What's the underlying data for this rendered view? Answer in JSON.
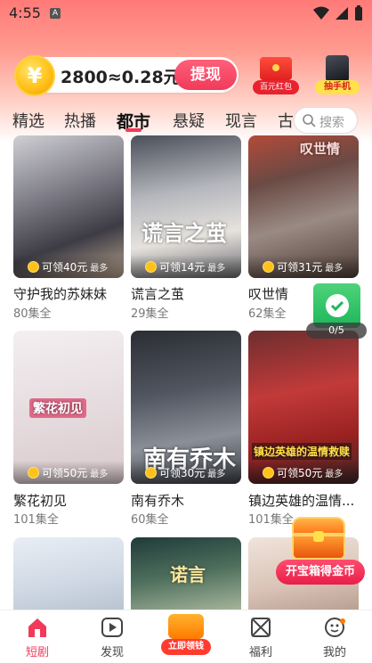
{
  "status_bar": {
    "time": "4:55",
    "notif_badge": "A"
  },
  "header": {
    "coin_text": "2800≈0.28元",
    "withdraw_label": "提现",
    "redpack_label": "百元红包",
    "phone_label": "抽手机",
    "coin_glyph": "¥"
  },
  "tabs": [
    "精选",
    "热播",
    "都市",
    "悬疑",
    "现言",
    "古言"
  ],
  "active_tab": "都市",
  "search": {
    "placeholder": "搜索"
  },
  "cards": [
    {
      "title": "守护我的苏妹妹",
      "episodes": "80集全",
      "reward": "可领40元",
      "more": "最多"
    },
    {
      "title": "谎言之茧",
      "episodes": "29集全",
      "reward": "可领14元",
      "more": "最多",
      "poster_text": "谎言之茧"
    },
    {
      "title": "叹世情",
      "episodes": "62集全",
      "reward": "可领31元",
      "more": "最多",
      "poster_text": "叹世情"
    },
    {
      "title": "繁花初见",
      "episodes": "101集全",
      "reward": "可领50元",
      "more": "最多",
      "poster_text": "繁花初见"
    },
    {
      "title": "南有乔木",
      "episodes": "60集全",
      "reward": "可领30元",
      "more": "最多",
      "poster_text": "南有乔木"
    },
    {
      "title": "镇边英雄的温情...",
      "episodes": "101集全",
      "reward": "可领50元",
      "more": "最多",
      "poster_text": "镇边英雄的温情救赎"
    },
    {
      "title": "",
      "episodes": "",
      "reward": "",
      "more": ""
    },
    {
      "title": "",
      "episodes": "",
      "reward": "",
      "more": "",
      "poster_text": "诺言"
    },
    {
      "title": "",
      "episodes": "",
      "reward": "",
      "more": ""
    }
  ],
  "floating": {
    "progress": "0/5",
    "treasure_label": "开宝箱得金币"
  },
  "bottom_nav": [
    {
      "label": "短剧",
      "active": true
    },
    {
      "label": "发现",
      "active": false
    },
    {
      "label": "立即领钱",
      "active": false
    },
    {
      "label": "福利",
      "active": false
    },
    {
      "label": "我的",
      "active": false
    }
  ],
  "colors": {
    "accent": "#f13a5a",
    "coin": "#ffc21a"
  }
}
